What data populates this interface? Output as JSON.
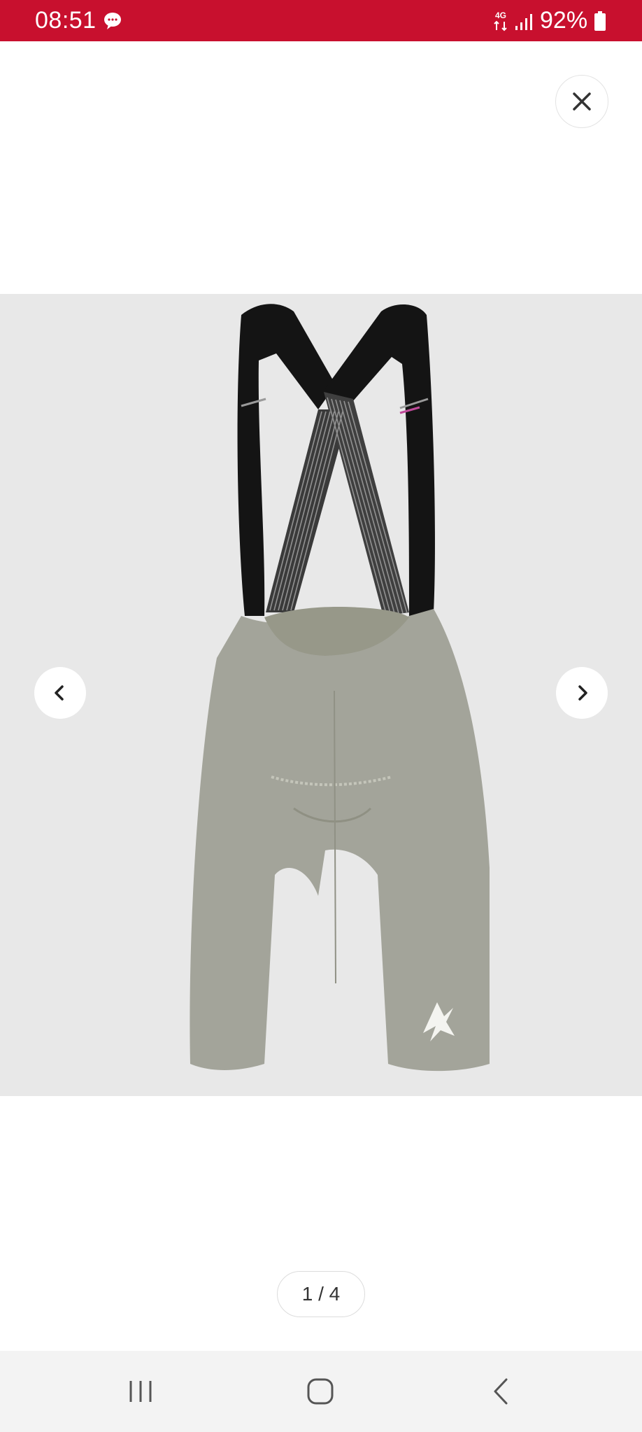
{
  "status_bar": {
    "time": "08:51",
    "network": "4G",
    "battery": "92%",
    "color": "#c8102e"
  },
  "viewer": {
    "close_icon": "close-icon",
    "prev_icon": "chevron-left-icon",
    "next_icon": "chevron-right-icon",
    "image_background": "#e8e8e8",
    "product_color": "#a3a49a",
    "pager": {
      "current": 1,
      "total": 4,
      "label": "1 / 4"
    }
  },
  "system_nav": {
    "recents_icon": "recents-icon",
    "home_icon": "home-icon",
    "back_icon": "back-icon"
  }
}
